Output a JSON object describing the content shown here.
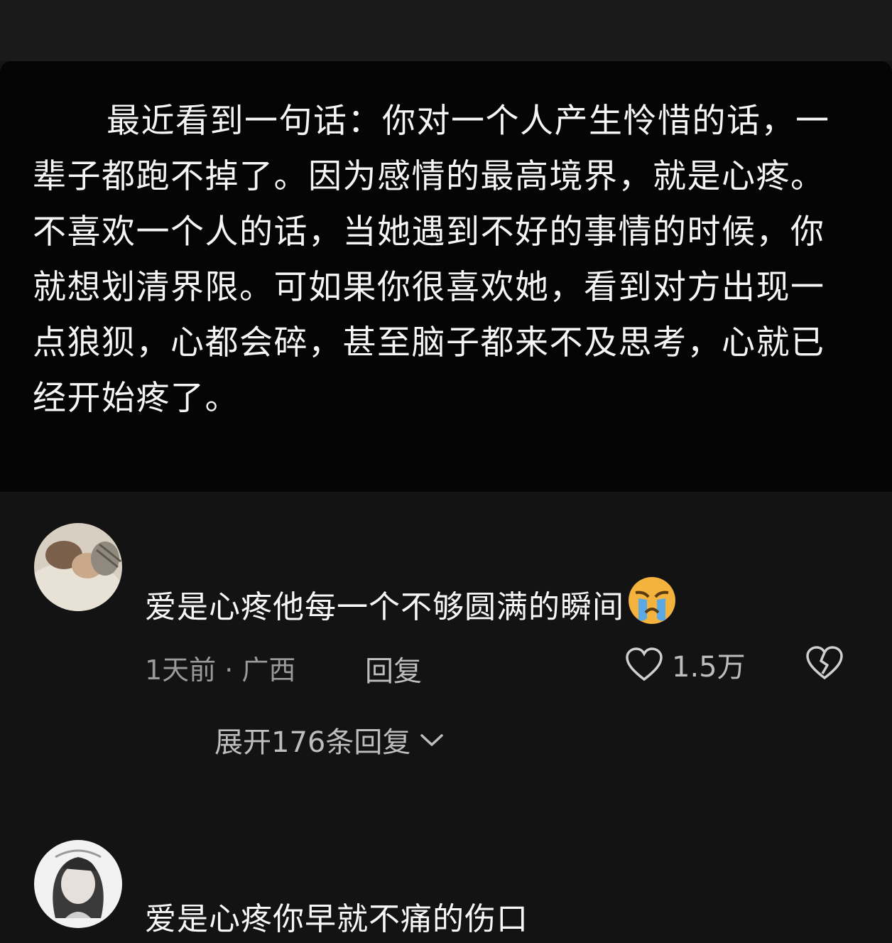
{
  "post": {
    "text": "最近看到一句话：你对一个人产生怜惜的话，一辈子都跑不掉了。因为感情的最高境界，就是心疼。不喜欢一个人的话，当她遇到不好的事情的时候，你就想划清界限。可如果你很喜欢她，看到对方出现一点狼狈，心都会碎，甚至脑子都来不及思考，心就已经开始疼了。"
  },
  "comments": [
    {
      "text": "爱是心疼他每一个不够圆满的瞬间",
      "emoji": "crying-face-emoji",
      "time_location": "1天前 · 广西",
      "reply_label": "回复",
      "likes": "1.5万",
      "expand_label": "展开176条回复"
    },
    {
      "text": "爱是心疼你早就不痛的伤口"
    }
  ],
  "colors": {
    "background": "#131313",
    "post_background": "#050505",
    "meta_text": "#9a9a9a",
    "emoji": "#f3b33d"
  }
}
